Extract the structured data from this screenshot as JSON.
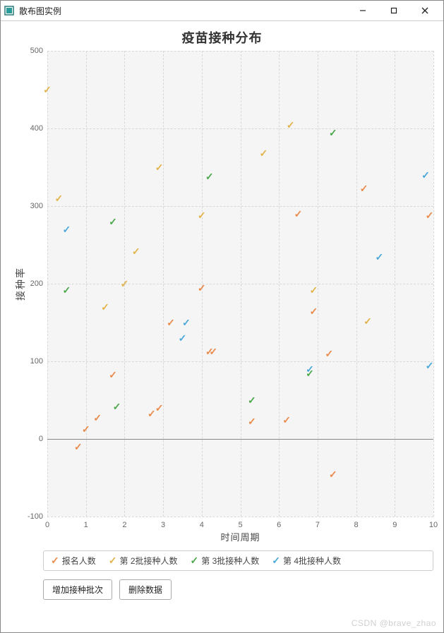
{
  "window": {
    "title": "散布图实例",
    "minimize_tooltip": "Minimize",
    "maximize_tooltip": "Maximize",
    "close_tooltip": "Close"
  },
  "chart_data": {
    "type": "scatter",
    "title": "疫苗接种分布",
    "xlabel": "时间周期",
    "ylabel": "接种率",
    "xlim": [
      0,
      10
    ],
    "ylim": [
      -100,
      500
    ],
    "xticks": [
      0,
      1,
      2,
      3,
      4,
      5,
      6,
      7,
      8,
      9,
      10
    ],
    "yticks": [
      -100,
      0,
      100,
      200,
      300,
      400,
      500
    ],
    "grid": true,
    "legend_position": "bottom",
    "series": [
      {
        "name": "报名人数",
        "color": "#e98a4a",
        "x": [
          0.8,
          1,
          1.3,
          1.7,
          2.7,
          2.9,
          3.2,
          4,
          4.2,
          4.3,
          5.3,
          6.2,
          6.5,
          6.9,
          7.3,
          7.4,
          8.2,
          9.9
        ],
        "y": [
          -10,
          13,
          27,
          83,
          33,
          40,
          150,
          195,
          113,
          113,
          23,
          25,
          290,
          165,
          110,
          -45,
          323,
          288
        ]
      },
      {
        "name": "第 2批接种人数",
        "color": "#e2b34a",
        "x": [
          0,
          0.3,
          1.5,
          2,
          2.3,
          2.9,
          4,
          5.6,
          6.3,
          6.9,
          8.3
        ],
        "y": [
          450,
          310,
          170,
          200,
          242,
          350,
          288,
          368,
          405,
          192,
          152
        ]
      },
      {
        "name": "第 3批接种人数",
        "color": "#4aa84a",
        "x": [
          0.5,
          1.7,
          1.8,
          4.2,
          5.3,
          6.8,
          7.4
        ],
        "y": [
          192,
          280,
          42,
          338,
          50,
          85,
          395
        ]
      },
      {
        "name": "第 4批接种人数",
        "color": "#4aa8d8",
        "x": [
          0.5,
          3.5,
          3.6,
          6.8,
          8.6,
          9.8,
          9.9
        ],
        "y": [
          270,
          130,
          150,
          90,
          235,
          340,
          95
        ]
      }
    ]
  },
  "legend": {
    "items": [
      "报名人数",
      "第 2批接种人数",
      "第 3批接种人数",
      "第 4批接种人数"
    ]
  },
  "buttons": {
    "add": "增加接种批次",
    "remove": "删除数据"
  },
  "watermark": "CSDN @brave_zhao"
}
